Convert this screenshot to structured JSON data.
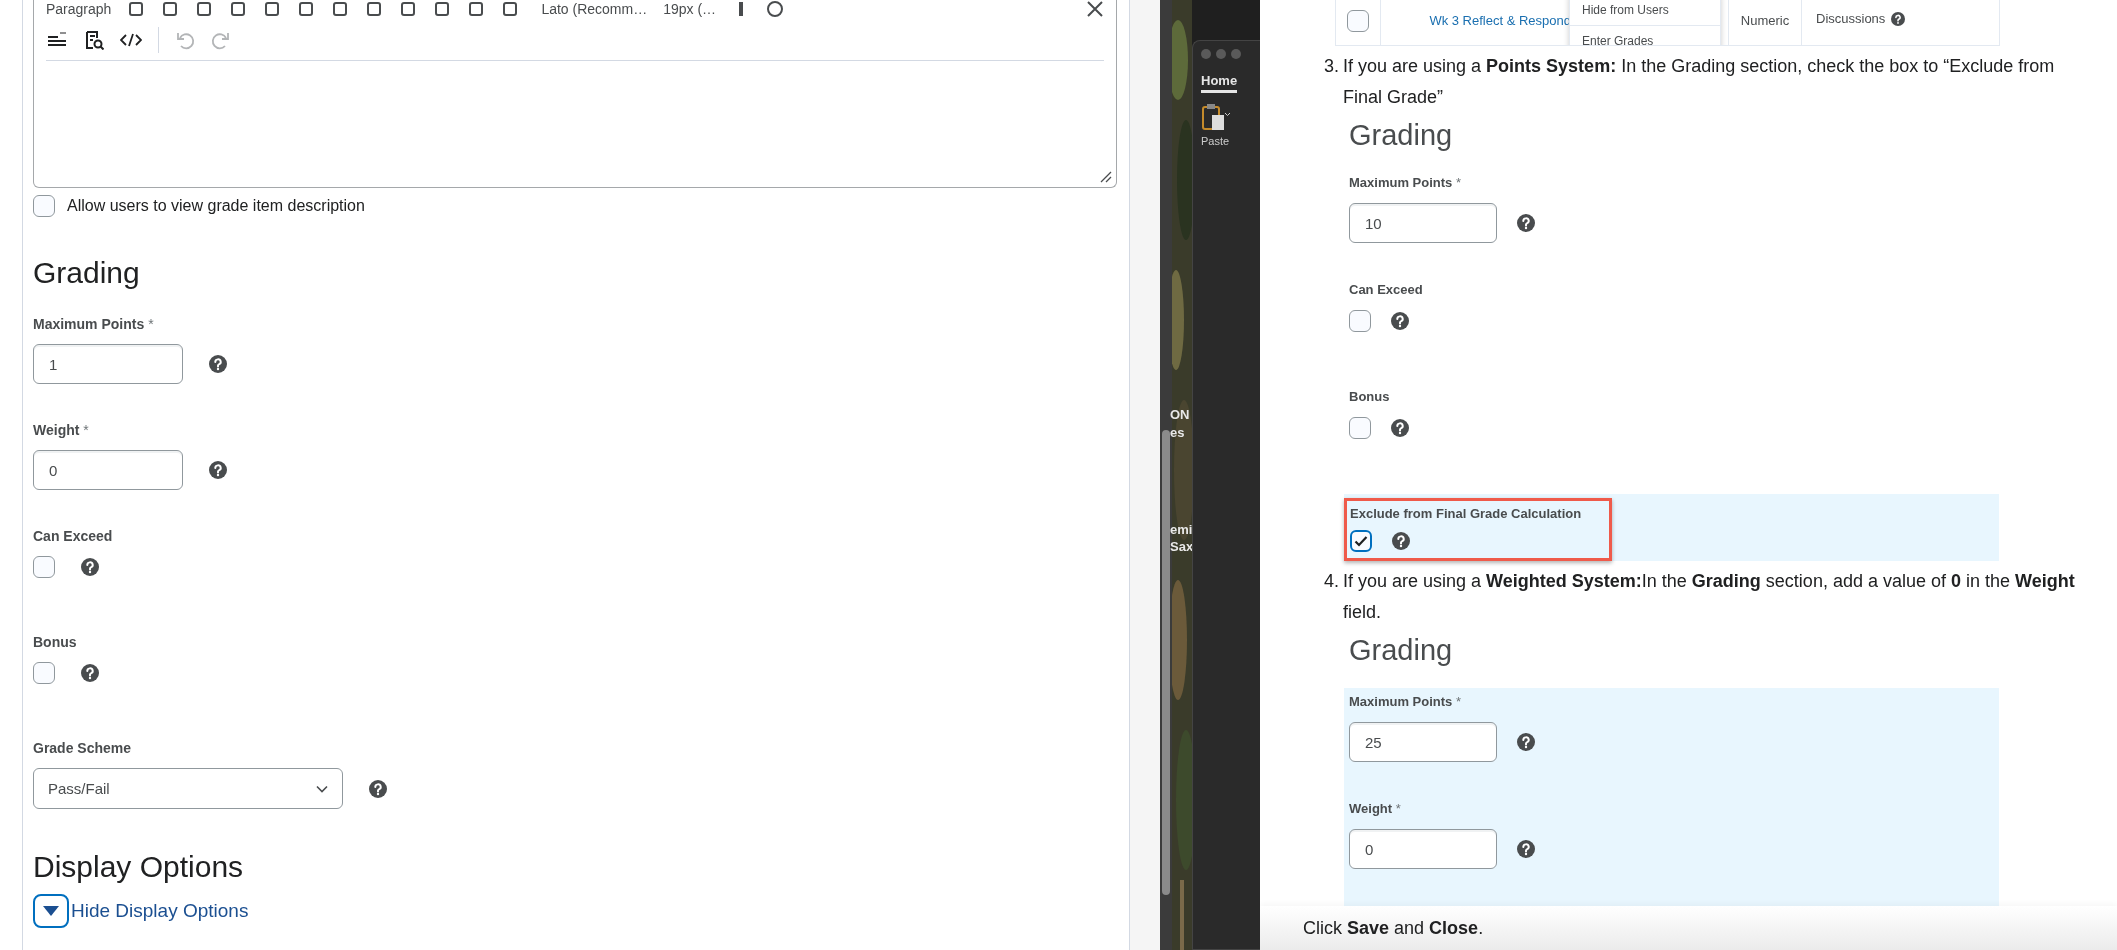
{
  "editor": {
    "toolbar_top": [
      "Paragraph",
      "Lato (Recomm…",
      "19px (…"
    ],
    "description_option": {
      "label": "Allow users to view grade item description",
      "checked": false
    }
  },
  "grading": {
    "heading": "Grading",
    "sections": [
      {
        "highlighted": false,
        "outlined": false,
        "fields": [
          {
            "kind": "text",
            "label": "Maximum Points",
            "required_mark": "*",
            "value": "1"
          },
          {
            "kind": "text",
            "label": "Weight",
            "required_mark": "*",
            "value": "0"
          },
          {
            "kind": "checkbox",
            "label": "Can Exceed",
            "checked": false
          },
          {
            "kind": "checkbox",
            "label": "Bonus",
            "checked": false
          },
          {
            "kind": "select",
            "label": "Grade Scheme",
            "value": "Pass/Fail"
          }
        ]
      }
    ]
  },
  "display_options": {
    "heading": "Display Options",
    "toggle": {
      "label": "Hide Display Options",
      "expanded": true
    }
  },
  "background_app": {
    "tab": "Home",
    "paste": "Paste",
    "fragments": [
      "ON",
      "es",
      "emi",
      "Sax"
    ]
  },
  "guide": {
    "table_row": {
      "checked": false,
      "link": "Wk 3 Reflect & Respond",
      "menu": [
        "Hide from Users",
        "Enter Grades"
      ],
      "type": "Numeric",
      "category": "Discussions"
    },
    "steps": [
      {
        "number": "3.",
        "text": "If you are using a **Points System:** In the Grading section, check the box to “Exclude from Final Grade”",
        "figure": {
          "heading": "Grading",
          "sections": [
            {
              "highlighted": false,
              "outlined": false,
              "fields": [
                {
                  "kind": "text",
                  "label": "Maximum Points",
                  "required_mark": "*",
                  "value": "10"
                },
                {
                  "kind": "checkbox",
                  "label": "Can Exceed",
                  "checked": false
                },
                {
                  "kind": "checkbox",
                  "label": "Bonus",
                  "checked": false
                }
              ]
            },
            {
              "highlighted": true,
              "outlined": true,
              "fields": [
                {
                  "kind": "checkbox",
                  "label": "Exclude from Final Grade Calculation",
                  "checked": true
                }
              ]
            }
          ]
        }
      },
      {
        "number": "4.",
        "text": "If you are using a **Weighted System:**In the **Grading** section, add a value of **0** in the **Weight** field.",
        "figure": {
          "heading": "Grading",
          "sections": [
            {
              "highlighted": true,
              "outlined": false,
              "fields": [
                {
                  "kind": "text",
                  "label": "Maximum Points",
                  "required_mark": "*",
                  "value": "25"
                },
                {
                  "kind": "text",
                  "label": "Weight",
                  "required_mark": "*",
                  "value": "0"
                }
              ]
            }
          ]
        }
      }
    ],
    "footer": "Click **Save** and **Close**."
  }
}
